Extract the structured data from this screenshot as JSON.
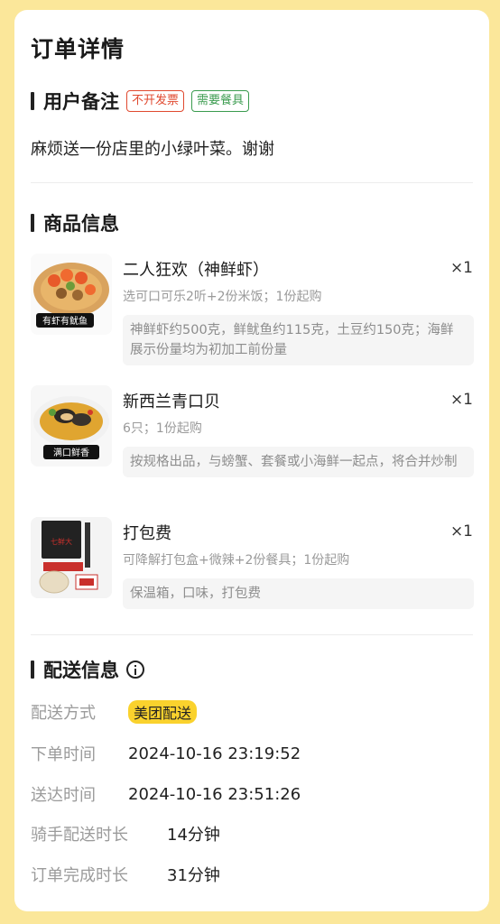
{
  "title": "订单详情",
  "remarks": {
    "heading": "用户备注",
    "tags": [
      "不开发票",
      "需要餐具"
    ],
    "text": "麻烦送一份店里的小绿叶菜。谢谢"
  },
  "products": {
    "heading": "商品信息",
    "items": [
      {
        "name": "二人狂欢（神鲜虾）",
        "qty": "×1",
        "spec": "选可口可乐2听+2份米饭；1份起购",
        "note": "神鲜虾约500克，鲜鱿鱼约115克，土豆约150克；海鲜展示份量均为初加工前份量",
        "image_label": "有虾有鱿鱼"
      },
      {
        "name": "新西兰青口贝",
        "qty": "×1",
        "spec": "6只；1份起购",
        "note": "按规格出品，与螃蟹、套餐或小海鲜一起点，将合并炒制",
        "image_label": "满口鲜香"
      },
      {
        "name": "打包费",
        "qty": "×1",
        "spec": "可降解打包盒+微辣+2份餐具；1份起购",
        "note": "保温箱，口味，打包费",
        "image_label": "七鲜大"
      }
    ]
  },
  "delivery": {
    "heading": "配送信息",
    "rows": [
      {
        "key": "配送方式",
        "value": "美团配送"
      },
      {
        "key": "下单时间",
        "value": "2024-10-16 23:19:52"
      },
      {
        "key": "送达时间",
        "value": "2024-10-16 23:51:26"
      },
      {
        "key": "骑手配送时长",
        "value": "14分钟"
      },
      {
        "key": "订单完成时长",
        "value": "31分钟"
      }
    ]
  }
}
